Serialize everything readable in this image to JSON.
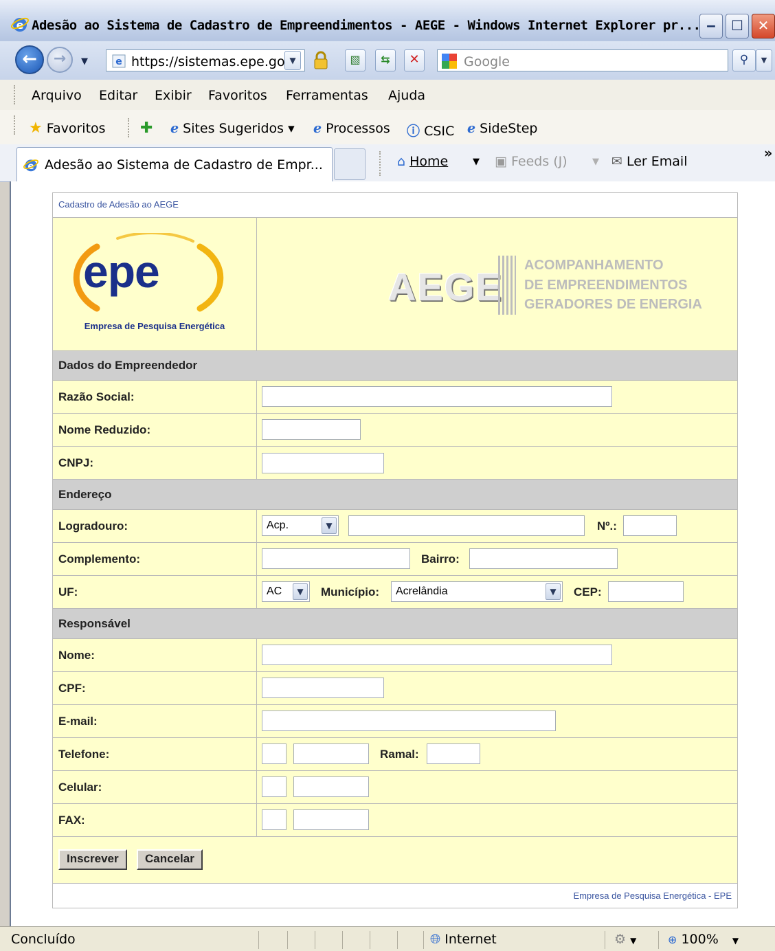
{
  "window": {
    "title": "Adesão ao Sistema de Cadastro de Empreendimentos - AEGE - Windows Internet Explorer pr...",
    "minimize": "‒",
    "maximize": "☐",
    "close": "✕"
  },
  "address": {
    "url": "https://sistemas.epe.go",
    "search_placeholder": "Google"
  },
  "menu": [
    "Arquivo",
    "Editar",
    "Exibir",
    "Favoritos",
    "Ferramentas",
    "Ajuda"
  ],
  "favorites": {
    "label": "Favoritos",
    "items": [
      "Sites Sugeridos ▾",
      "Processos",
      "CSIC",
      "SideStep"
    ]
  },
  "tabs": {
    "active": "Adesão ao Sistema de Cadastro de Empr...",
    "home": "Home",
    "feeds": "Feeds (J)",
    "email": "Ler Email",
    "more": "»"
  },
  "page": {
    "breadcrumb": "Cadastro de Adesão ao AEGE",
    "logo_word": "epe",
    "logo_tagline": "Empresa de Pesquisa Energética",
    "aege_mark": "AEGE",
    "aege_lines": [
      "ACOMPANHAMENTO",
      "DE EMPREENDIMENTOS",
      "GERADORES DE ENERGIA"
    ],
    "sections": {
      "empreendedor": "Dados do Empreendedor",
      "endereco": "Endereço",
      "responsavel": "Responsável"
    },
    "labels": {
      "razao_social": "Razão Social:",
      "nome_reduzido": "Nome Reduzido:",
      "cnpj": "CNPJ:",
      "logradouro": "Logradouro:",
      "numero": "Nº.:",
      "complemento": "Complemento:",
      "bairro": "Bairro:",
      "uf": "UF:",
      "municipio": "Município:",
      "cep": "CEP:",
      "nome": "Nome:",
      "cpf": "CPF:",
      "email": "E-mail:",
      "telefone": "Telefone:",
      "ramal": "Ramal:",
      "celular": "Celular:",
      "fax": "FAX:"
    },
    "selects": {
      "logradouro_tipo": "Acp.",
      "uf": "AC",
      "municipio": "Acrelândia"
    },
    "buttons": {
      "inscrever": "Inscrever",
      "cancelar": "Cancelar"
    },
    "footer": "Empresa de Pesquisa Energética - EPE"
  },
  "status": {
    "text": "Concluído",
    "zone": "Internet",
    "zoom": "100%"
  }
}
